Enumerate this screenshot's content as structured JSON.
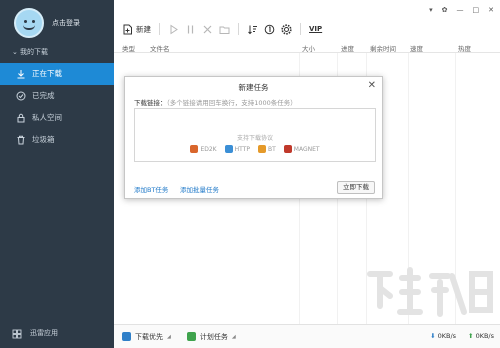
{
  "user": {
    "login_label": "点击登录"
  },
  "sidebar": {
    "section_label": "我的下载",
    "items": [
      {
        "label": "正在下载",
        "icon": "download-arrow-icon",
        "active": true
      },
      {
        "label": "已完成",
        "icon": "check-circle-icon",
        "active": false
      },
      {
        "label": "私人空间",
        "icon": "lock-icon",
        "active": false
      },
      {
        "label": "垃圾箱",
        "icon": "trash-icon",
        "active": false
      }
    ],
    "addon_label": "迅雷应用"
  },
  "window_controls": [
    "▾",
    "✿",
    "—",
    "□",
    "✕"
  ],
  "toolbar": {
    "new_label": "新建",
    "vip_label": "VIP"
  },
  "columns": [
    "类型",
    "文件名",
    "大小",
    "进度",
    "剩余时间",
    "速度",
    "热度"
  ],
  "dialog": {
    "title": "新建任务",
    "close_glyph": "✕",
    "link_label": "下载链接：",
    "link_hint": "（多个链接请用回车换行，支持1000条任务）",
    "protocols_title": "支持下载协议",
    "protocols": [
      {
        "name": "ED2K",
        "color": "#d9662c"
      },
      {
        "name": "HTTP",
        "color": "#3b8fd6"
      },
      {
        "name": "BT",
        "color": "#e59a2a"
      },
      {
        "name": "MAGNET",
        "color": "#c0392b"
      }
    ],
    "add_bt_label": "添加BT任务",
    "add_batch_label": "添加批量任务",
    "download_now_label": "立即下载"
  },
  "statusbar": {
    "priority_label": "下载优先",
    "schedule_label": "计划任务",
    "down_speed": "0KB/s",
    "up_speed": "0KB/s"
  },
  "colors": {
    "sidebar_bg": "#2d3a47",
    "active_item": "#1e8ad6",
    "link": "#1e78c8"
  }
}
